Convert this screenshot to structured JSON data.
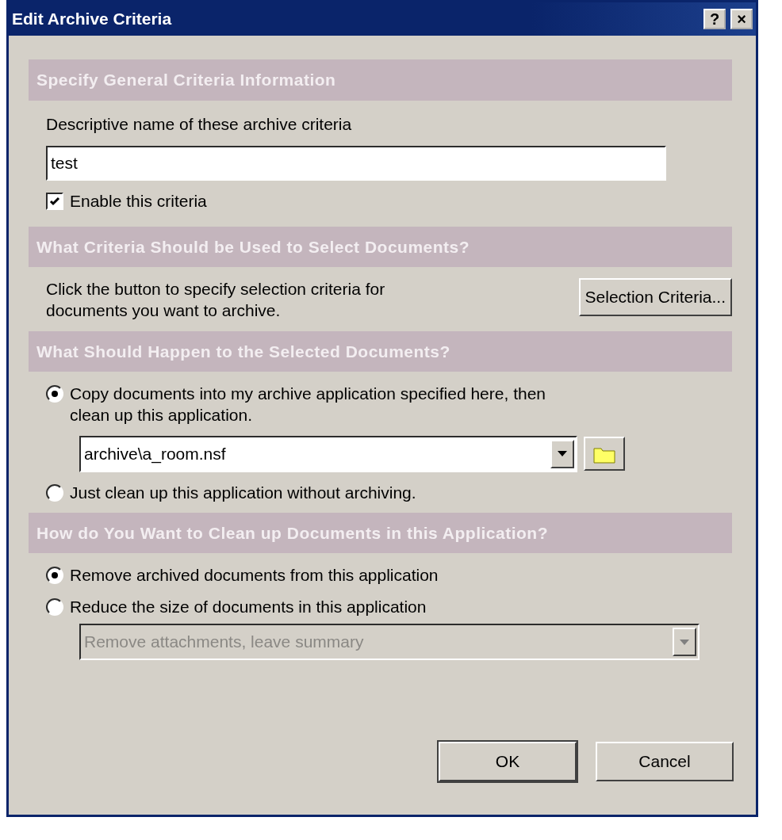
{
  "window": {
    "title": "Edit Archive Criteria",
    "title_buttons": [
      "?",
      "×"
    ]
  },
  "general": {
    "heading": "Specify General Criteria Information",
    "name_label": "Descriptive name of these archive criteria",
    "name_value": "test",
    "enable": {
      "label": "Enable this criteria",
      "checked": true
    }
  },
  "selection": {
    "heading": "What Criteria Should be Used to Select Documents?",
    "description": "Click the button to specify selection criteria for documents you want to archive.",
    "button": "Selection Criteria..."
  },
  "action": {
    "heading": "What Should Happen to the Selected Documents?",
    "options": [
      {
        "label": "Copy documents into my archive application specified here, then clean up this application.",
        "selected": true
      },
      {
        "label": "Just clean up this application without archiving.",
        "selected": false
      }
    ],
    "archive_path": "archive\\a_room.nsf"
  },
  "cleanup": {
    "heading": "How do You Want to Clean up Documents in this Application?",
    "options": [
      {
        "label": "Remove archived documents from this application",
        "selected": true
      },
      {
        "label": "Reduce the size of documents in this application",
        "selected": false
      }
    ],
    "reduce_mode": {
      "value": "Remove attachments, leave summary",
      "disabled": true
    }
  },
  "buttons": [
    {
      "label": "OK",
      "default": true
    },
    {
      "label": "Cancel",
      "default": false
    }
  ]
}
